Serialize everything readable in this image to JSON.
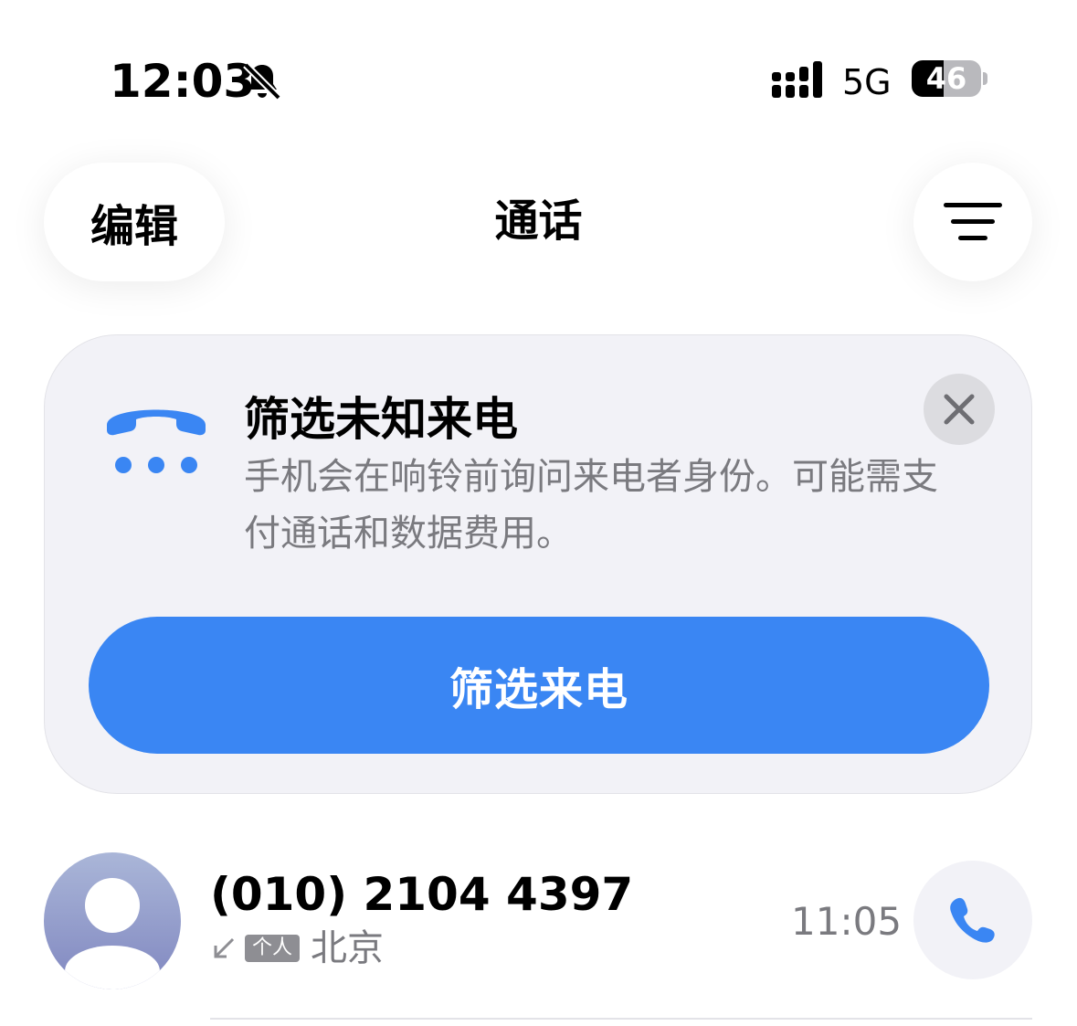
{
  "status_bar": {
    "time": "12:03",
    "silent_icon": "bell-slash-icon",
    "signal_icon": "cellular-signal-icon",
    "network": "5G",
    "battery_level": "46"
  },
  "nav": {
    "edit_label": "编辑",
    "title": "通话",
    "filter_icon": "filter-lines-icon"
  },
  "screening_card": {
    "icon": "phone-screening-icon",
    "title": "筛选未知来电",
    "description": "手机会在响铃前询问来电者身份。可能需支付通话和数据费用。",
    "close_icon": "close-icon",
    "button_label": "筛选来电"
  },
  "recents": [
    {
      "number": "(010) 2104 4397",
      "direction_icon": "incoming-arrow-icon",
      "tag": "个人",
      "location": "北京",
      "time": "11:05",
      "call_icon": "phone-icon"
    }
  ],
  "colors": {
    "accent": "#3a86f3",
    "card_bg": "#f2f2f7",
    "secondary_text": "#7a7a7f"
  }
}
